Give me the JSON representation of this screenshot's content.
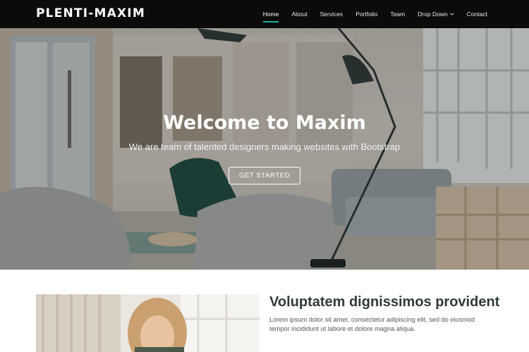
{
  "brand": {
    "logo": "PLENTI-MAXIM"
  },
  "nav": {
    "items": [
      {
        "label": "Home",
        "active": true
      },
      {
        "label": "About"
      },
      {
        "label": "Services"
      },
      {
        "label": "Portfolio"
      },
      {
        "label": "Team"
      },
      {
        "label": "Drop Down",
        "icon": "chevron-down-icon"
      },
      {
        "label": "Contact"
      }
    ]
  },
  "hero": {
    "title": "Welcome to Maxim",
    "subtitle": "We are team of talented designers making websites with Bootstrap",
    "cta_label": "GET STARTED"
  },
  "about": {
    "title": "Voluptatem dignissimos provident",
    "text": "Lorem ipsum dolor sit amet, consectetur adipiscing elit, sed do eiusmod tempor incididunt ut labore et dolore magna aliqua."
  },
  "colors": {
    "accent": "#1bb1a5",
    "header_bg": "#0b0b0b"
  }
}
